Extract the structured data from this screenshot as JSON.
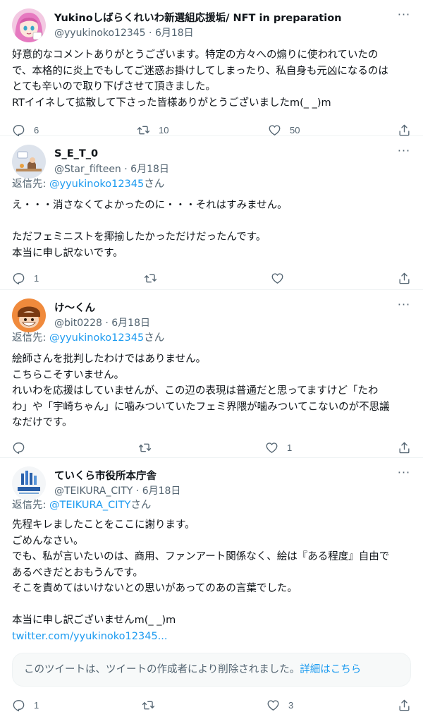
{
  "colors": {
    "accent": "#1d9bf0",
    "secondary_text": "#536471",
    "primary_text": "#0f1419",
    "divider": "#eff3f4"
  },
  "more_icon": "more-icon",
  "tweets": [
    {
      "display_name": "Yukinoしばらくれいわ新選組応援垢/ NFT in preparation",
      "handle": "@yyukinoko12345",
      "sep": " · ",
      "date": "6月18日",
      "more_label": "···",
      "text": [
        "好意的なコメントありがとうございます。特定の方々への煽りに使われていたの",
        "で、本格的に炎上でもしてご迷惑お掛けしてしまったり、私自身も元凶になるのは",
        "とても辛いので取り下げさせて頂きました。",
        "RTイイネして拡散して下さった皆様ありがとうございましたm(_ _)m"
      ],
      "reply_count": "6",
      "retweet_count": "10",
      "like_count": "50"
    },
    {
      "display_name": "S_E_T_0",
      "handle": "@Star_fifteen",
      "sep": " · ",
      "date": "6月18日",
      "more_label": "···",
      "reply_prefix": "返信先: ",
      "reply_mention": "@yyukinoko12345",
      "reply_suffix": "さん",
      "text": [
        "え・・・消さなくてよかったのに・・・それはすみません。",
        "",
        "ただフェミニストを揶揄したかっただけだったんです。",
        "本当に申し訳ないです。"
      ],
      "reply_count": "1",
      "retweet_count": "",
      "like_count": ""
    },
    {
      "display_name": "け～くん",
      "handle": "@bit0228",
      "sep": " · ",
      "date": "6月18日",
      "more_label": "···",
      "reply_prefix": "返信先: ",
      "reply_mention": "@yyukinoko12345",
      "reply_suffix": "さん",
      "text": [
        "絵師さんを批判したわけではありません。",
        "こちらこそすいません。",
        "れいわを応援はしていませんが、この辺の表現は普通だと思ってますけど「たわ",
        "わ」や「宇崎ちゃん」に噛みついていたフェミ界隈が噛みついてこないのが不思議",
        "なだけです。"
      ],
      "reply_count": "",
      "retweet_count": "",
      "like_count": "1"
    },
    {
      "display_name": "ていくら市役所本庁舎",
      "handle": "@TEIKURA_CITY",
      "sep": " · ",
      "date": "6月18日",
      "more_label": "···",
      "reply_prefix": "返信先: ",
      "reply_mention": "@TEIKURA_CITY",
      "reply_suffix": "さん",
      "text": [
        "先程キレましたことをここに謝ります。",
        "ごめんなさい。",
        "でも、私が言いたいのは、商用、ファンアート関係なく、絵は『ある程度』自由で",
        "あるべきだとおもうんです。",
        "そこを責めてはいけないとの思いがあってのあの言葉でした。",
        "",
        "本当に申し訳ございませんm(_ _)m"
      ],
      "link_text": "twitter.com/yyukinoko12345...",
      "deleted_text": "このツイートは、ツイートの作成者により削除されました。",
      "deleted_link": "詳細はこちら",
      "reply_count": "1",
      "retweet_count": "",
      "like_count": "3"
    }
  ]
}
